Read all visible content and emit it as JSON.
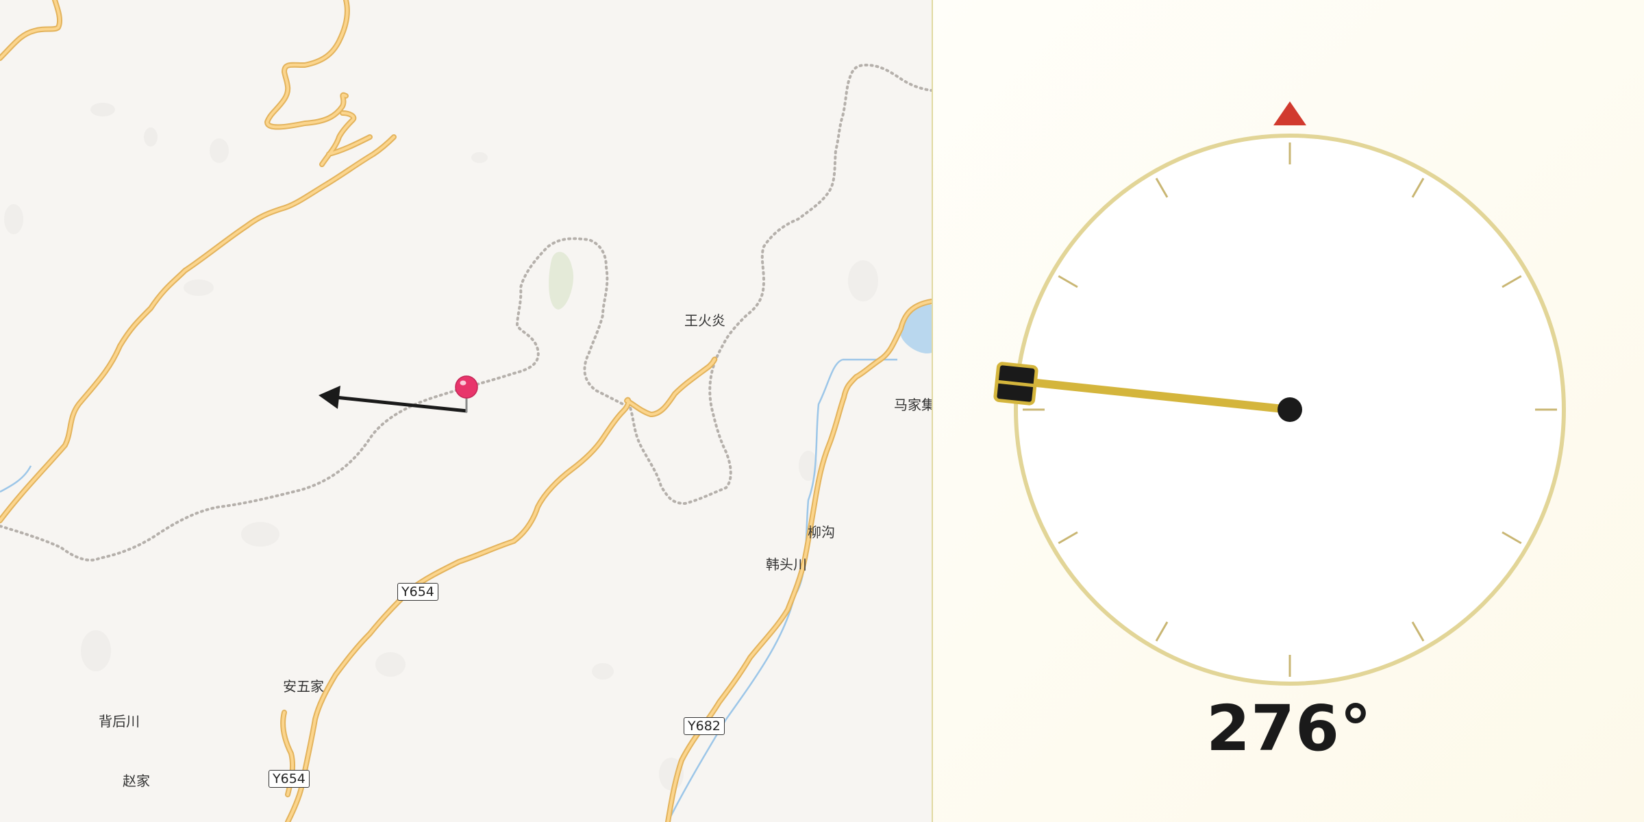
{
  "map": {
    "places": [
      {
        "id": "wanghuoyan",
        "label": "王火炎"
      },
      {
        "id": "majiaji",
        "label": "马家集"
      },
      {
        "id": "liugou",
        "label": "柳沟"
      },
      {
        "id": "hantouchuan",
        "label": "韩头川"
      },
      {
        "id": "anwujia",
        "label": "安五家"
      },
      {
        "id": "beihouchuan",
        "label": "背后川"
      },
      {
        "id": "zhaojia",
        "label": "赵家"
      }
    ],
    "shields": [
      "Y654",
      "Y682",
      "Y654"
    ],
    "colors": {
      "road": "#f5c871",
      "road_casing": "#e8b45c",
      "boundary": "#b5b0ab",
      "water": "#b9d7ee",
      "river": "#9cc6e8",
      "pin": "#e8356b"
    }
  },
  "compass": {
    "heading_deg": 276,
    "heading_text": "276°",
    "colors": {
      "ring": "#e2d597",
      "tick": "#c9b673",
      "needle": "#d4b53c",
      "north": "#d13a2e",
      "hub": "#1a1a1a"
    }
  }
}
